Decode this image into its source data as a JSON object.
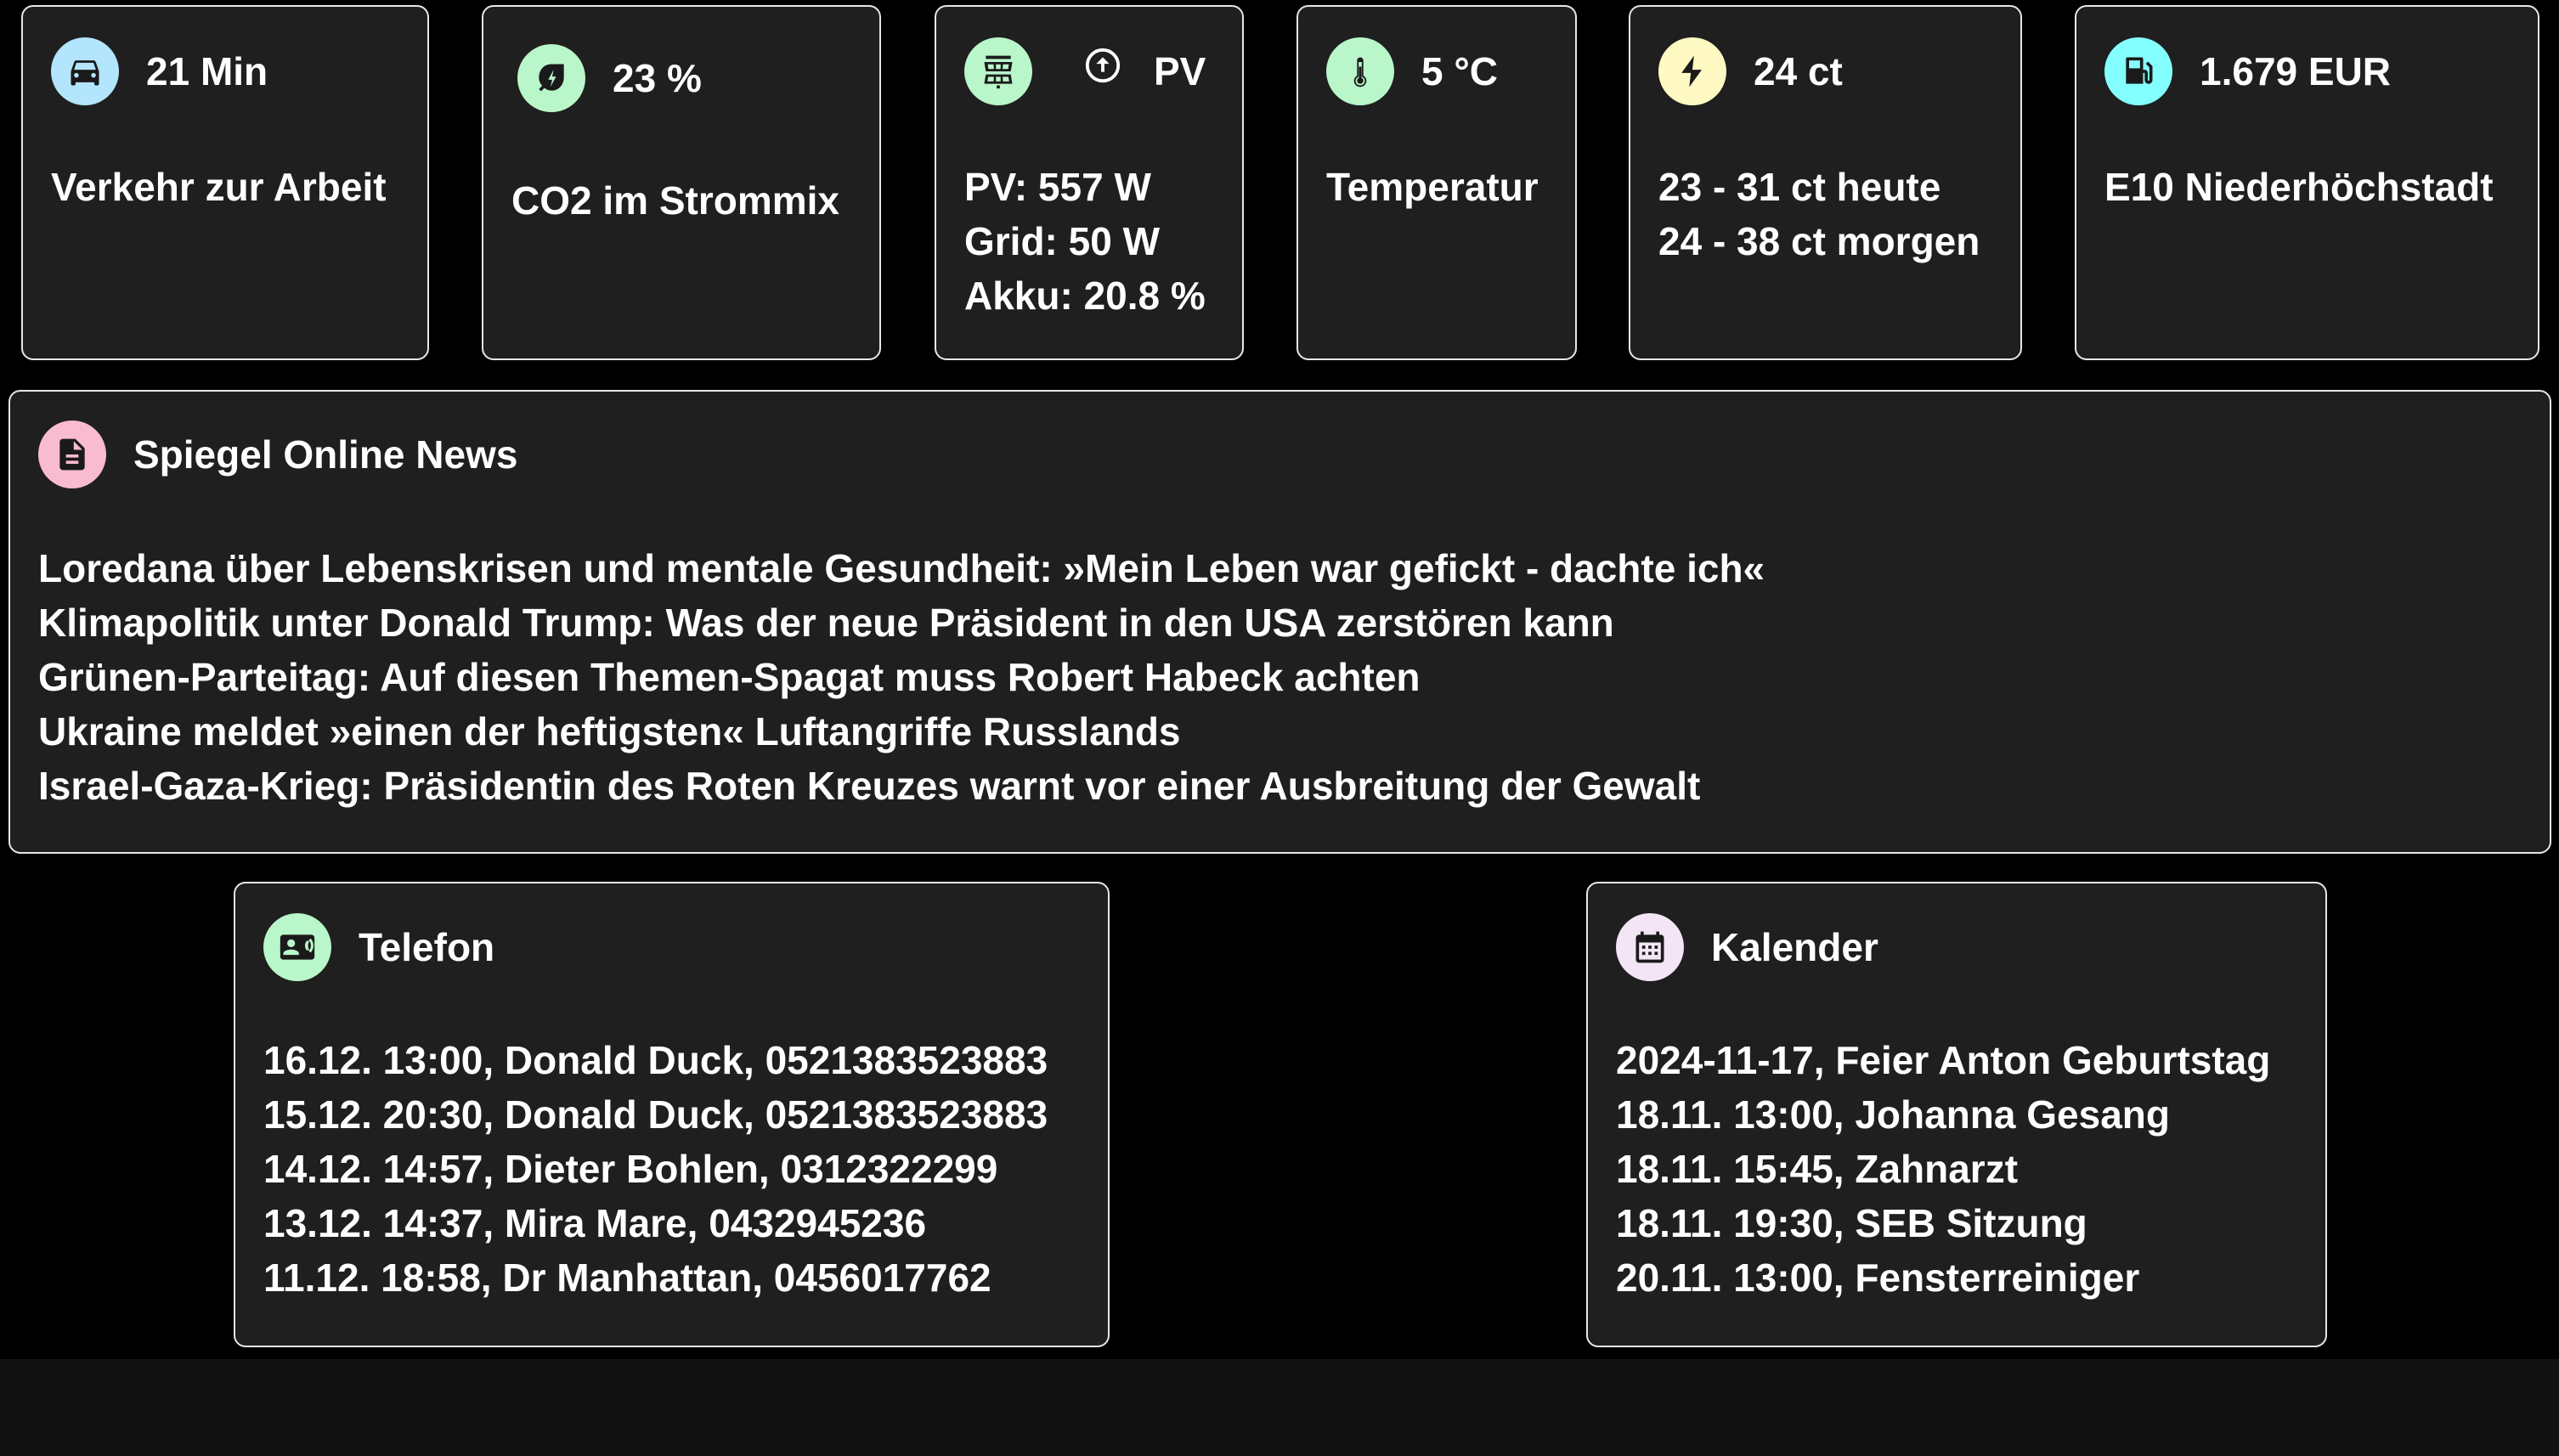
{
  "colors": {
    "car": "#b3e5fc",
    "co2": "#b9f6ca",
    "pv": "#b9f6ca",
    "temp": "#b9f6ca",
    "price": "#fff9c4",
    "fuel": "#84ffff",
    "news": "#f8bbd0",
    "phone": "#b9f6ca",
    "calendar": "#f3e5f5"
  },
  "tiles": {
    "traffic": {
      "icon": "car-icon",
      "value": "21 Min",
      "label": "Verkehr zur Arbeit"
    },
    "co2": {
      "icon": "leaf-bolt-icon",
      "value": "23 %",
      "label": "CO2 im Strommix"
    },
    "pv": {
      "icon": "solar-panel-icon",
      "sub_icon": "arrow-up-circle-icon",
      "value": "PV",
      "lines": [
        "PV: 557 W",
        "Grid: 50 W",
        "Akku: 20.8 %"
      ]
    },
    "temperature": {
      "icon": "thermometer-icon",
      "value": "5 °C",
      "label": "Temperatur"
    },
    "price": {
      "icon": "lightning-icon",
      "value": "24 ct",
      "lines": [
        "23 - 31 ct heute",
        "24 - 38 ct morgen"
      ]
    },
    "fuel": {
      "icon": "gas-station-icon",
      "value": "1.679 EUR",
      "label": "E10 Niederhöchstadt"
    }
  },
  "news": {
    "icon": "document-icon",
    "title": "Spiegel Online News",
    "items": [
      "Loredana über Lebenskrisen und mentale Gesundheit: »Mein Leben war gefickt - dachte ich«",
      "Klimapolitik unter Donald Trump: Was der neue Präsident in den USA zerstören kann",
      "Grünen-Parteitag: Auf diesen Themen-Spagat muss Robert Habeck achten",
      "Ukraine meldet »einen der heftigsten« Luftangriffe Russlands",
      "Israel-Gaza-Krieg: Präsidentin des Roten Kreuzes warnt vor einer Ausbreitung der Gewalt"
    ]
  },
  "phone": {
    "icon": "contact-card-icon",
    "title": "Telefon",
    "items": [
      "16.12. 13:00, Donald Duck, 0521383523883",
      "15.12. 20:30, Donald Duck, 0521383523883",
      "14.12. 14:57, Dieter Bohlen, 0312322299",
      "13.12. 14:37, Mira Mare, 0432945236",
      "11.12. 18:58, Dr Manhattan, 0456017762"
    ]
  },
  "calendar": {
    "icon": "calendar-icon",
    "title": "Kalender",
    "items": [
      "2024-11-17, Feier Anton Geburtstag",
      "18.11. 13:00, Johanna Gesang",
      "18.11. 15:45, Zahnarzt",
      "18.11. 19:30, SEB Sitzung",
      "20.11. 13:00, Fensterreiniger"
    ]
  }
}
